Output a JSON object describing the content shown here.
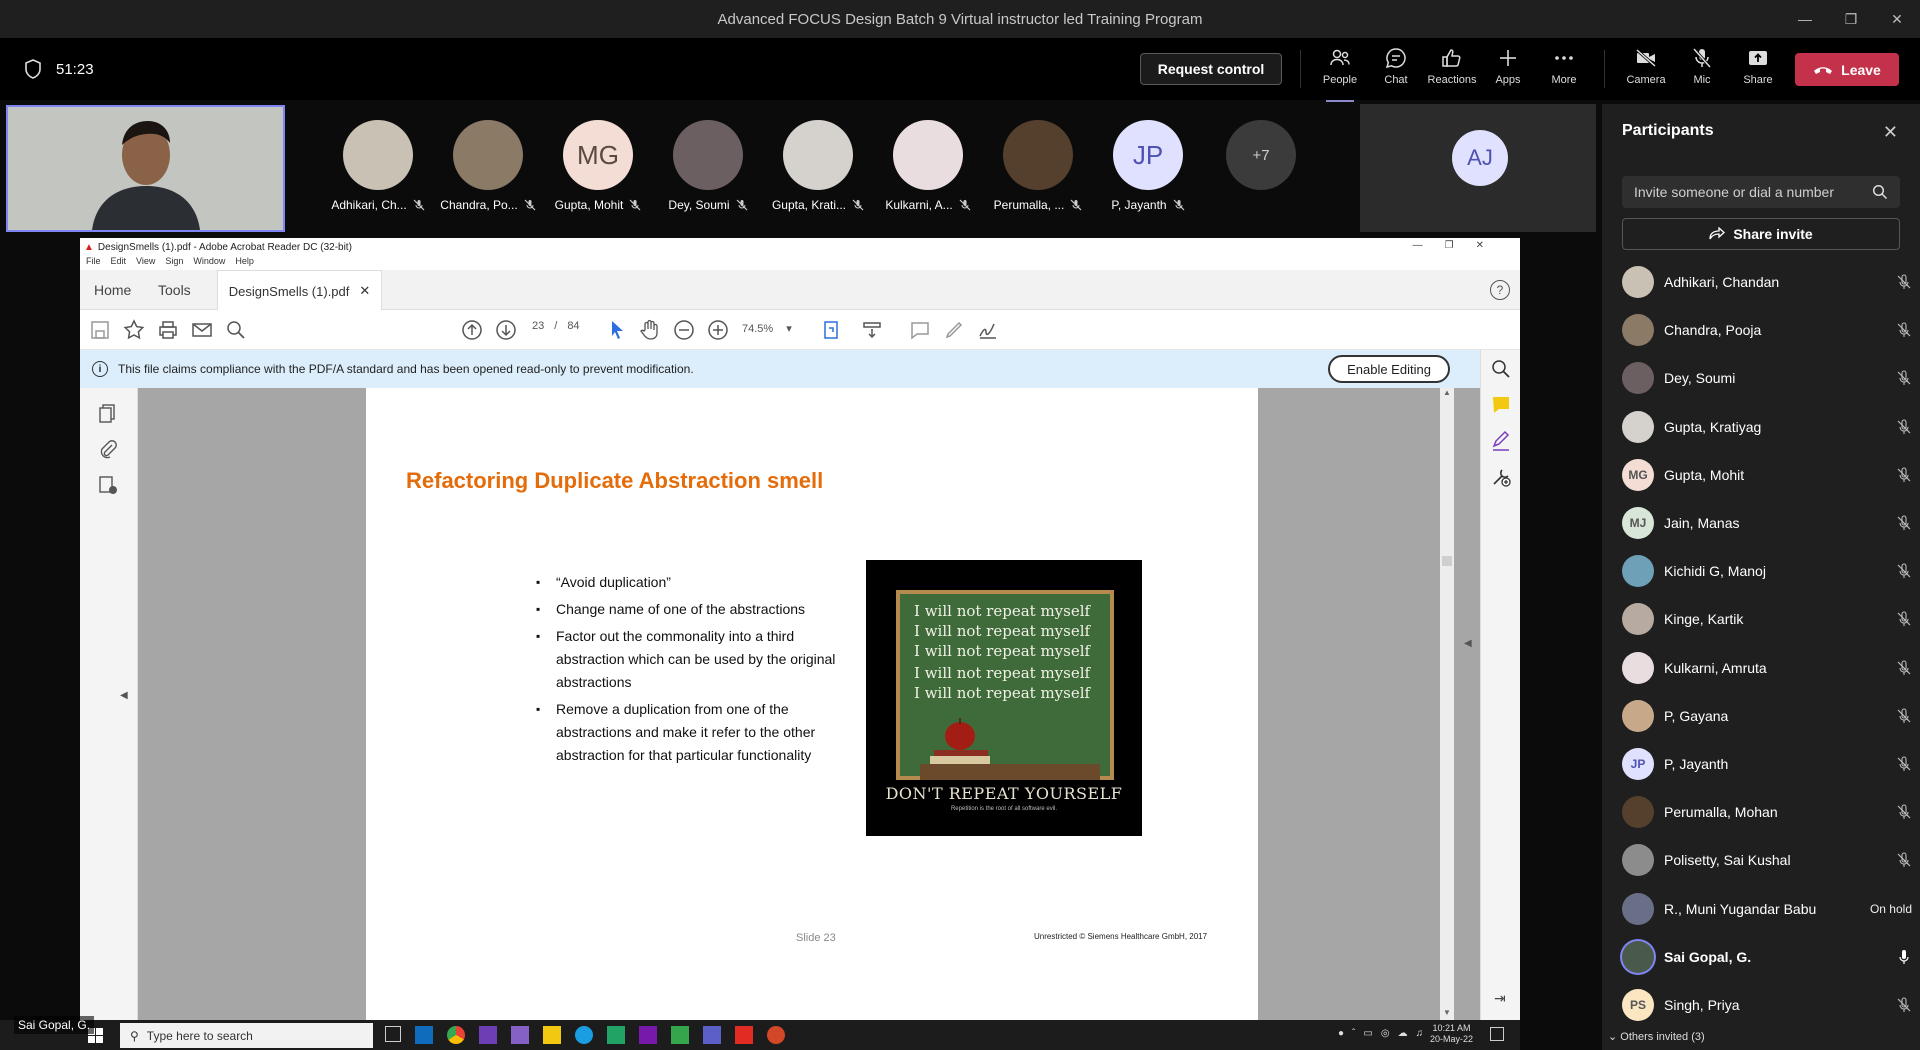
{
  "window": {
    "title": "Advanced FOCUS Design Batch 9 Virtual instructor led Training Program"
  },
  "toolbar": {
    "timer": "51:23",
    "request_control": "Request control",
    "buttons": [
      {
        "label": "People",
        "icon": "people-icon"
      },
      {
        "label": "Chat",
        "icon": "chat-icon"
      },
      {
        "label": "Reactions",
        "icon": "reactions-icon"
      },
      {
        "label": "Apps",
        "icon": "plus-icon"
      },
      {
        "label": "More",
        "icon": "more-icon"
      },
      {
        "label": "Camera",
        "icon": "camera-off-icon"
      },
      {
        "label": "Mic",
        "icon": "mic-off-icon"
      },
      {
        "label": "Share",
        "icon": "share-icon"
      }
    ],
    "leave": "Leave"
  },
  "gallery": {
    "tiles": [
      {
        "name": "Adhikari, Ch...",
        "initials": "",
        "color": "#c9c2b4"
      },
      {
        "name": "Chandra, Po...",
        "initials": "",
        "color": "#8a7a66"
      },
      {
        "name": "Gupta, Mohit",
        "initials": "MG",
        "color": "#f3ddd5"
      },
      {
        "name": "Dey, Soumi",
        "initials": "",
        "color": "#6b5f62"
      },
      {
        "name": "Gupta, Krati...",
        "initials": "",
        "color": "#d5d1cc"
      },
      {
        "name": "Kulkarni, A...",
        "initials": "",
        "color": "#e9dde0"
      },
      {
        "name": "Perumalla, ...",
        "initials": "",
        "color": "#54402d"
      },
      {
        "name": "P, Jayanth",
        "initials": "JP",
        "color": "#dfe1ff"
      }
    ],
    "overflow": "+7",
    "spotlight_initials": "AJ",
    "self_name": "Sai Gopal, G."
  },
  "participants": {
    "title": "Participants",
    "invite_placeholder": "Invite someone or dial a number",
    "share_invite": "Share invite",
    "list": [
      {
        "name": "Adhikari, Chandan",
        "initials": "",
        "color": "#c9c2b4",
        "status": "muted"
      },
      {
        "name": "Chandra, Pooja",
        "initials": "",
        "color": "#8a7a66",
        "status": "muted"
      },
      {
        "name": "Dey, Soumi",
        "initials": "",
        "color": "#6b5f62",
        "status": "muted"
      },
      {
        "name": "Gupta, Kratiyag",
        "initials": "",
        "color": "#d5d1cc",
        "status": "muted"
      },
      {
        "name": "Gupta, Mohit",
        "initials": "MG",
        "color": "#f3ddd5",
        "status": "muted"
      },
      {
        "name": "Jain, Manas",
        "initials": "MJ",
        "color": "#d8e6d8",
        "status": "muted"
      },
      {
        "name": "Kichidi G, Manoj",
        "initials": "",
        "color": "#6ea0b8",
        "status": "muted"
      },
      {
        "name": "Kinge, Kartik",
        "initials": "",
        "color": "#b7aaa0",
        "status": "muted"
      },
      {
        "name": "Kulkarni, Amruta",
        "initials": "",
        "color": "#e9dde0",
        "status": "muted"
      },
      {
        "name": "P, Gayana",
        "initials": "",
        "color": "#c7a98a",
        "status": "muted"
      },
      {
        "name": "P, Jayanth",
        "initials": "JP",
        "color": "#dfe1ff",
        "status": "muted"
      },
      {
        "name": "Perumalla, Mohan",
        "initials": "",
        "color": "#54402d",
        "status": "muted"
      },
      {
        "name": "Polisetty, Sai Kushal",
        "initials": "",
        "color": "#8c8c8c",
        "status": "muted"
      },
      {
        "name": "R., Muni Yugandar Babu",
        "initials": "",
        "color": "#6a6f88",
        "status": "On hold"
      },
      {
        "name": "Sai Gopal, G.",
        "initials": "",
        "color": "#4a5a4a",
        "status": "speaking"
      },
      {
        "name": "Singh, Priya",
        "initials": "PS",
        "color": "#fbe6c2",
        "status": "muted"
      }
    ],
    "others_invited": "Others invited (3)"
  },
  "acrobat": {
    "title": "DesignSmells (1).pdf - Adobe Acrobat Reader DC (32-bit)",
    "menu": [
      "File",
      "Edit",
      "View",
      "Sign",
      "Window",
      "Help"
    ],
    "tabs": {
      "home": "Home",
      "tools": "Tools",
      "doc": "DesignSmells (1).pdf"
    },
    "page_current": "23",
    "page_sep": "/",
    "page_total": "84",
    "zoom": "74.5%",
    "info": "This file claims compliance with the PDF/A standard and has been opened read-only to prevent modification.",
    "enable_editing": "Enable Editing"
  },
  "slide": {
    "title": "Refactoring Duplicate Abstraction smell",
    "bullets": [
      "“Avoid duplication”",
      "Change name of one of the abstractions",
      "Factor out the commonality into a third abstraction which can be used by the original abstractions",
      "Remove a duplication from one of the abstractions and make it refer to the other abstraction for that particular functionality"
    ],
    "poster_lines": [
      "I will not repeat myself",
      "I will  not repeat myself",
      "I will not  repeat myself",
      "I will not repeat myself",
      "I will not repeat myself"
    ],
    "poster_caption": "DON'T REPEAT YOURSELF",
    "poster_sub": "Repetition is the root of all software evil.",
    "slide_number": "Slide 23",
    "copyright": "Unrestricted © Siemens Healthcare GmbH, 2017"
  },
  "taskbar": {
    "search_placeholder": "Type here to search",
    "time": "10:21 AM",
    "date": "20-May-22"
  }
}
